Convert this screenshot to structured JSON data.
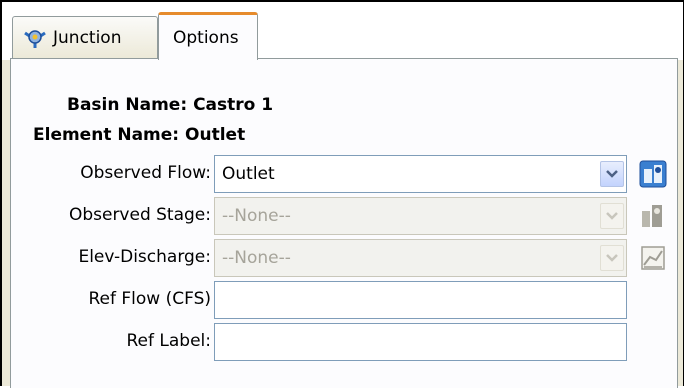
{
  "tabs": [
    {
      "label": "Junction",
      "icon": "junction-icon"
    },
    {
      "label": "Options",
      "active": true
    }
  ],
  "info": {
    "basin_label": "Basin Name:",
    "basin_value": "Castro 1",
    "element_label": "Element Name:",
    "element_value": "Outlet"
  },
  "fields": {
    "observed_flow": {
      "label": "Observed Flow:",
      "value": "Outlet",
      "enabled": true,
      "button_icon": "data-manager-icon"
    },
    "observed_stage": {
      "label": "Observed Stage:",
      "value": "--None--",
      "enabled": false,
      "button_icon": "data-manager-icon"
    },
    "elev_discharge": {
      "label": "Elev-Discharge:",
      "value": "--None--",
      "enabled": false,
      "button_icon": "paired-data-icon"
    },
    "ref_flow": {
      "label": "Ref Flow (CFS)",
      "value": ""
    },
    "ref_label": {
      "label": "Ref Label:",
      "value": ""
    }
  },
  "colors": {
    "active_tab_accent": "#e68b2c",
    "panel_bg": "#fcfcfe",
    "input_border": "#7f9db9",
    "disabled_text": "#a6a49a"
  }
}
